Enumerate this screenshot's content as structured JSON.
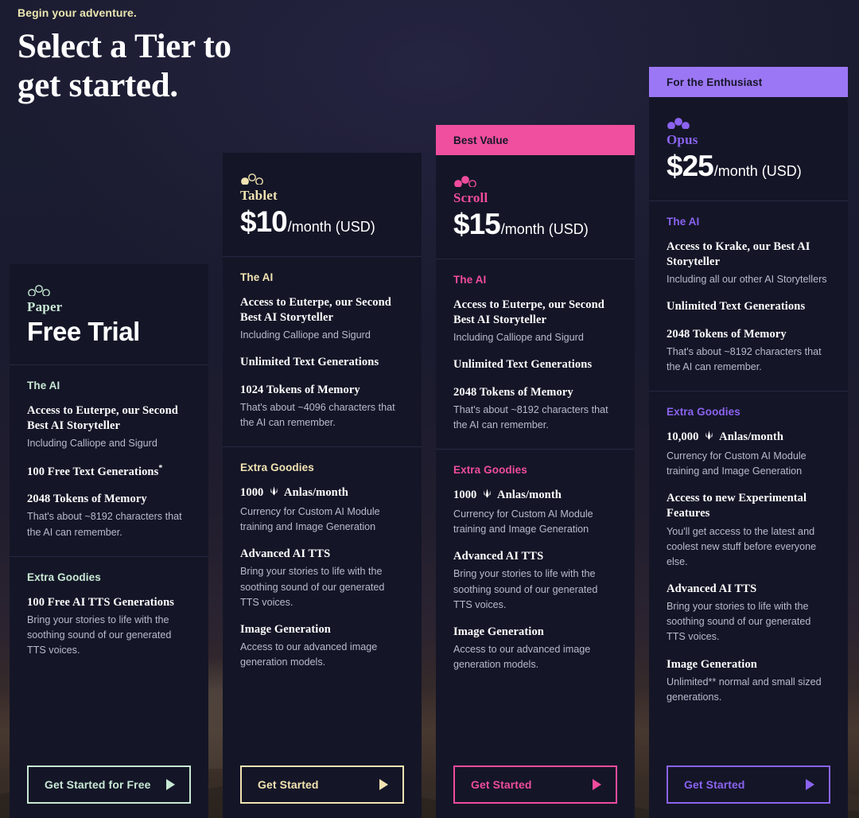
{
  "header": {
    "eyebrow": "Begin your adventure.",
    "title": "Select a Tier to\nget started."
  },
  "colors": {
    "paper": "#c8e8d4",
    "tablet": "#f2e3b2",
    "scroll": "#f04c9e",
    "opus": "#8b63f0",
    "scroll_ribbon": "#ef4f9e",
    "opus_ribbon": "#9c77f5",
    "card_bg": "#141627",
    "page_bg": "#191a2e"
  },
  "tiers": [
    {
      "id": "paper",
      "ribbon": null,
      "icon": "tier-dots-1-icon",
      "name": "Paper",
      "price_amount": "Free Trial",
      "price_suffix": "",
      "is_free": true,
      "accent": "#c8e8d4",
      "sections": [
        {
          "title": "The AI",
          "features": [
            {
              "title": "Access to Euterpe, our Second Best AI Storyteller",
              "desc": "Including Calliope and Sigurd"
            },
            {
              "title": "100 Free Text Generations",
              "sup": "*",
              "desc": ""
            },
            {
              "title": "2048 Tokens of Memory",
              "desc": "That's about ~8192 characters that the AI can remember."
            }
          ]
        },
        {
          "title": "Extra Goodies",
          "features": [
            {
              "title": "100 Free AI TTS Generations",
              "desc": "Bring your stories to life with the soothing sound of our generated TTS voices."
            }
          ]
        }
      ],
      "cta": "Get Started for Free"
    },
    {
      "id": "tablet",
      "ribbon": null,
      "icon": "tier-dots-2-icon",
      "name": "Tablet",
      "price_amount": "$10",
      "price_suffix": "/month (USD)",
      "is_free": false,
      "accent": "#f2e3b2",
      "sections": [
        {
          "title": "The AI",
          "features": [
            {
              "title": "Access to Euterpe, our Second Best AI Storyteller",
              "desc": "Including Calliope and Sigurd"
            },
            {
              "title": "Unlimited Text Generations",
              "desc": ""
            },
            {
              "title": "1024 Tokens of Memory",
              "desc": "That's about ~4096 characters that the AI can remember."
            }
          ]
        },
        {
          "title": "Extra Goodies",
          "features": [
            {
              "title": "1000 {anlas} Anlas/month",
              "desc": "Currency for Custom AI Module training and Image Generation"
            },
            {
              "title": "Advanced AI TTS",
              "desc": "Bring your stories to life with the soothing sound of our generated TTS voices."
            },
            {
              "title": "Image Generation",
              "desc": "Access to our advanced image generation models."
            }
          ]
        }
      ],
      "cta": "Get Started"
    },
    {
      "id": "scroll",
      "ribbon": "Best Value",
      "icon": "tier-dots-3-icon",
      "name": "Scroll",
      "price_amount": "$15",
      "price_suffix": "/month (USD)",
      "is_free": false,
      "accent": "#f04c9e",
      "sections": [
        {
          "title": "The AI",
          "features": [
            {
              "title": "Access to Euterpe, our Second Best AI Storyteller",
              "desc": "Including Calliope and Sigurd"
            },
            {
              "title": "Unlimited Text Generations",
              "desc": ""
            },
            {
              "title": "2048 Tokens of Memory",
              "desc": "That's about ~8192 characters that the AI can remember."
            }
          ]
        },
        {
          "title": "Extra Goodies",
          "features": [
            {
              "title": "1000 {anlas} Anlas/month",
              "desc": "Currency for Custom AI Module training and Image Generation"
            },
            {
              "title": "Advanced AI TTS",
              "desc": "Bring your stories to life with the soothing sound of our generated TTS voices."
            },
            {
              "title": "Image Generation",
              "desc": "Access to our advanced image generation models."
            }
          ]
        }
      ],
      "cta": "Get Started"
    },
    {
      "id": "opus",
      "ribbon": "For the Enthusiast",
      "icon": "tier-dots-4-icon",
      "name": "Opus",
      "price_amount": "$25",
      "price_suffix": "/month (USD)",
      "is_free": false,
      "accent": "#8b63f0",
      "sections": [
        {
          "title": "The AI",
          "features": [
            {
              "title": "Access to Krake, our Best AI Storyteller",
              "desc": "Including all our other AI Storytellers"
            },
            {
              "title": "Unlimited Text Generations",
              "desc": ""
            },
            {
              "title": "2048 Tokens of Memory",
              "desc": "That's about ~8192 characters that the AI can remember."
            }
          ]
        },
        {
          "title": "Extra Goodies",
          "features": [
            {
              "title": "10,000 {anlas} Anlas/month",
              "desc": "Currency for Custom AI Module training and Image Generation"
            },
            {
              "title": "Access to new Experimental Features",
              "desc": "You'll get access to the latest and coolest new stuff before everyone else."
            },
            {
              "title": "Advanced AI TTS",
              "desc": "Bring your stories to life with the soothing sound of our generated TTS voices."
            },
            {
              "title": "Image Generation",
              "desc": "Unlimited** normal and small sized generations."
            }
          ]
        }
      ],
      "cta": "Get Started"
    }
  ]
}
